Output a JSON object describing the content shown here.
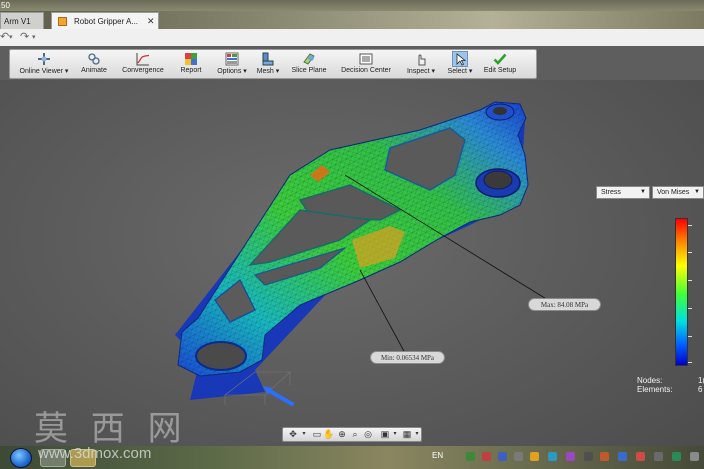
{
  "window": {
    "title_fragment": "50",
    "tabs": [
      {
        "label": "Arm V1"
      },
      {
        "label": "Robot Gripper A..."
      }
    ],
    "tab_close_glyph": "✕"
  },
  "quick_access": {
    "undo_icon": "undo-icon",
    "redo_icon": "redo-icon"
  },
  "toolbar": {
    "items": [
      {
        "label": "Online Viewer ▾",
        "icon": "online-viewer-icon"
      },
      {
        "label": "Animate",
        "icon": "animate-icon"
      },
      {
        "label": "Convergence",
        "icon": "convergence-icon"
      },
      {
        "label": "Report",
        "icon": "report-icon"
      },
      {
        "label": "Options ▾",
        "icon": "options-icon"
      },
      {
        "label": "Mesh ▾",
        "icon": "mesh-icon"
      },
      {
        "label": "Slice Plane",
        "icon": "slice-plane-icon"
      },
      {
        "label": "Decision Center",
        "icon": "decision-center-icon"
      },
      {
        "label": "Inspect ▾",
        "icon": "inspect-icon"
      },
      {
        "label": "Select ▾",
        "icon": "select-icon"
      },
      {
        "label": "Edit Setup",
        "icon": "edit-setup-icon"
      }
    ]
  },
  "probes": {
    "max_label": "Max: 84.08 MPa",
    "min_label": "Min: 0.06534 MPa"
  },
  "result_panel": {
    "result_type": "Stress",
    "component": "Von Mises",
    "nodes_label": "Nodes:",
    "nodes_value": "1(",
    "elements_label": "Elements:",
    "elements_value": "6"
  },
  "colors": {
    "legend_high": "#ff0000",
    "legend_mid": "#3cff3c",
    "legend_low": "#0000c8",
    "model_base": "#2fbf3a"
  },
  "watermark": {
    "chinese": "莫 西 网",
    "url": "www.3dmox.com"
  },
  "taskbar": {
    "language": "EN"
  }
}
